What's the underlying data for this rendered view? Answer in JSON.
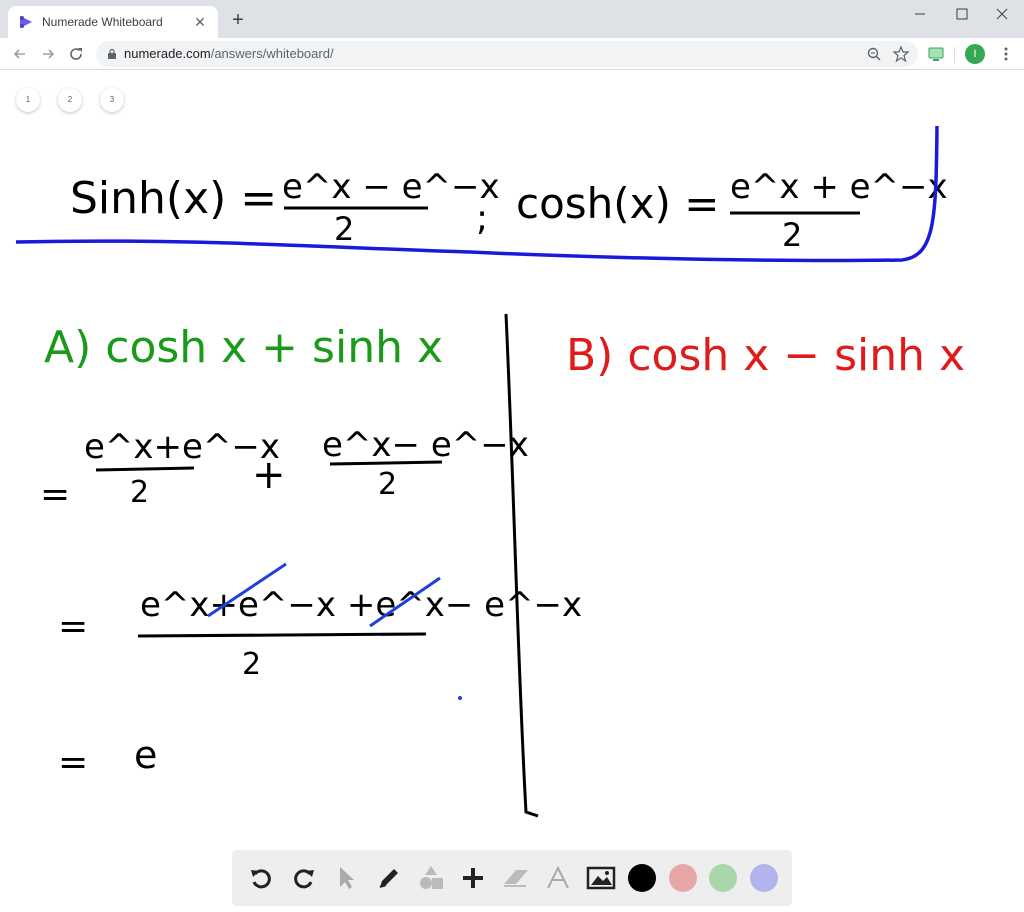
{
  "browser": {
    "tab_title": "Numerade Whiteboard",
    "url_host": "numerade.com",
    "url_path": "/answers/whiteboard/",
    "profile_initial": "I"
  },
  "pages": [
    "1",
    "2",
    "3"
  ],
  "whiteboard": {
    "def_sinh_lhs": "Sinh(x) =",
    "def_sinh_num": "e^x − e^−x",
    "def_den": "2",
    "def_sep": ";",
    "def_cosh_lhs": "cosh(x) =",
    "def_cosh_num": "e^x + e^−x",
    "partA_title": "A) cosh x + sinh x",
    "partB_title": "B) cosh x − sinh x",
    "line1_frac1_num": "e^x+e^−x",
    "line1_frac2_num": "e^x− e^−x",
    "line1_plus": "+",
    "line2_num": "e^x+e^−x +e^x− e^−x",
    "eq": "=",
    "line3_rhs": "e"
  },
  "tools": {
    "icons": [
      "undo-icon",
      "redo-icon",
      "pointer-icon",
      "pen-icon",
      "shapes-icon",
      "plus-icon",
      "eraser-icon",
      "text-icon",
      "image-icon"
    ],
    "colors": [
      "#000000",
      "#e8a6a6",
      "#a9d7a9",
      "#b3b3ee"
    ]
  },
  "colors": {
    "header_ink": "#000000",
    "underline_ink": "#1a1adb",
    "partA_ink": "#1a9a1a",
    "partB_ink": "#e01b1b",
    "strike_ink": "#2040d8"
  }
}
